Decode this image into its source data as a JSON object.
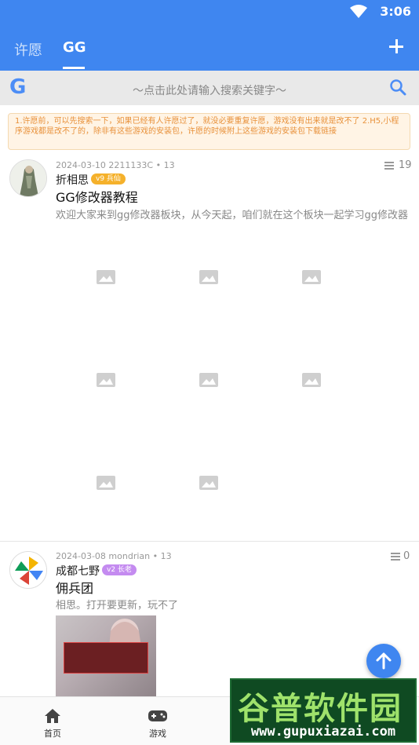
{
  "status_bar": {
    "time": "3:06"
  },
  "tabs": [
    {
      "label": "许愿"
    },
    {
      "label": "GG"
    }
  ],
  "search": {
    "logo": "G",
    "placeholder": "～点击此处请输入搜索关键字～"
  },
  "notice": {
    "text": "1.许愿前，可以先搜索一下，如果已经有人许愿过了，就没必要重复许愿，游戏没有出来就是改不了 2.H5,小程序游戏都是改不了的，除非有这些游戏的安装包，许愿的时候附上这些游戏的安装包下载链接"
  },
  "posts": [
    {
      "meta": "2024-03-10 2211133C • 13",
      "comment_count": "19",
      "author": "折相思",
      "badge": "v9 兵仙",
      "title": "GG修改器教程",
      "summary": "欢迎大家来到gg修改器板块，从今天起，咱们就在这个板块一起学习gg修改器"
    },
    {
      "meta": "2024-03-08 mondrian • 13",
      "comment_count": "0",
      "author": "成都七野",
      "badge": "v2 长老",
      "title": "佣兵团",
      "summary": "相思。打开要更新，玩不了"
    }
  ],
  "bottom_nav": [
    {
      "label": "首页",
      "icon": "home-icon"
    },
    {
      "label": "游戏",
      "icon": "gamepad-icon"
    }
  ],
  "watermark": {
    "title": "谷普软件园",
    "url": "www.gupuxiazai.com"
  },
  "colors": {
    "primary": "#3f86f0",
    "notice_text": "#e8913a",
    "badge_gold": "#f5b12b",
    "badge_purple": "#c48bf0"
  }
}
